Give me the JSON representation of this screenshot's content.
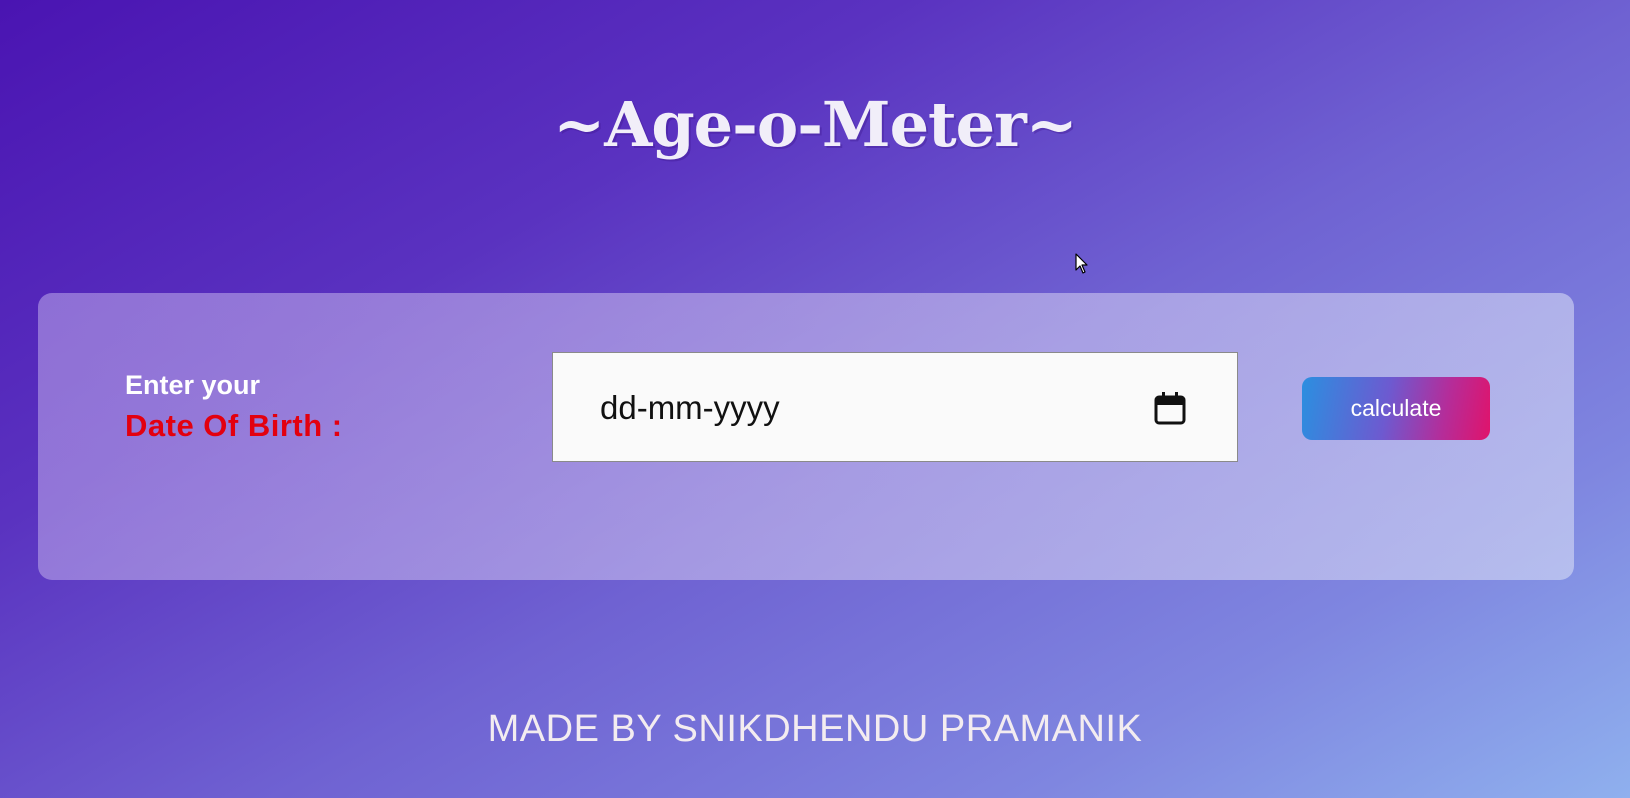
{
  "app": {
    "title": "~Age-o-Meter~"
  },
  "form": {
    "label_line1": "Enter your",
    "label_line2": "Date Of Birth :",
    "date_input": {
      "placeholder": "dd-mm-yyyy",
      "value": ""
    },
    "calculate_label": "calculate"
  },
  "footer": {
    "credit": "MADE BY SNIKDHENDU PRAMANIK"
  },
  "icons": {
    "calendar": "calendar-icon",
    "cursor": "mouse-pointer-icon"
  },
  "colors": {
    "title": "#f1eef9",
    "label_primary": "#ffffff",
    "label_accent": "#e3000f",
    "button_start": "#2b8fe0",
    "button_end": "#e0136b",
    "footer_text": "#f3ecf0"
  }
}
